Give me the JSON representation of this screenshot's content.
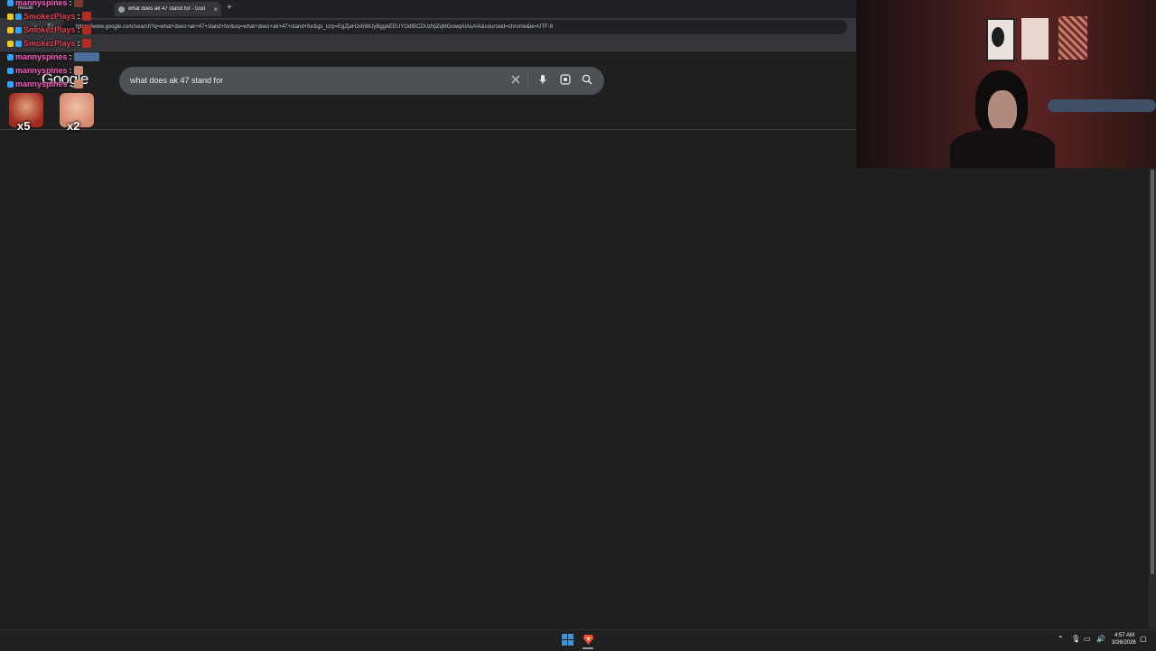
{
  "browser": {
    "tab_title": "what does ak 47 stand for - Goo",
    "tab_close": "×",
    "new_tab": "+",
    "url": "https://www.google.com/search?q=what+does+ak+47+stand+for&oq=what+does+ak+47+stand+for&gs_lcrp=EgZjaHJvbWUyBggAEEUYOdIBCDUzNjZqMGowqAIAsAIA&sourceid=chrome&ie=UTF-8"
  },
  "google": {
    "logo": "Google",
    "query": "what does ak 47 stand for"
  },
  "chat": {
    "messages": [
      {
        "user": "mannyspines",
        "color": "#ff5ec8",
        "suffix": ":"
      },
      {
        "user": "SmokezPlays",
        "color": "#e5405a",
        "suffix": ":"
      },
      {
        "user": "SmokezPlays",
        "color": "#e5405a",
        "suffix": ":"
      },
      {
        "user": "SmokezPlays",
        "color": "#e5405a",
        "suffix": ":"
      },
      {
        "user": "mannyspines",
        "color": "#ff5ec8",
        "suffix": ":"
      },
      {
        "user": "mannyspines",
        "color": "#ff5ec8",
        "suffix": ":"
      },
      {
        "user": "mannyspines",
        "color": "#ff5ec8",
        "suffix": ":"
      }
    ],
    "overlay_small": {
      "results": "Results"
    },
    "emote_counts": [
      {
        "count": "x5"
      },
      {
        "count": "x2"
      }
    ]
  },
  "taskbar": {
    "time": "4:57 AM",
    "date": "3/26/2026"
  },
  "colors": {
    "page_bg": "#1f1f1f",
    "searchbox": "#4d5156",
    "accent_win": "#0078d4",
    "brave": "#fb542b"
  },
  "icons": [
    "close-icon",
    "mic-icon",
    "lens-icon",
    "search-icon",
    "windows-start-icon",
    "brave-browser-icon",
    "chevron-up-icon",
    "speaker-icon",
    "network-icon",
    "notification-icon"
  ]
}
